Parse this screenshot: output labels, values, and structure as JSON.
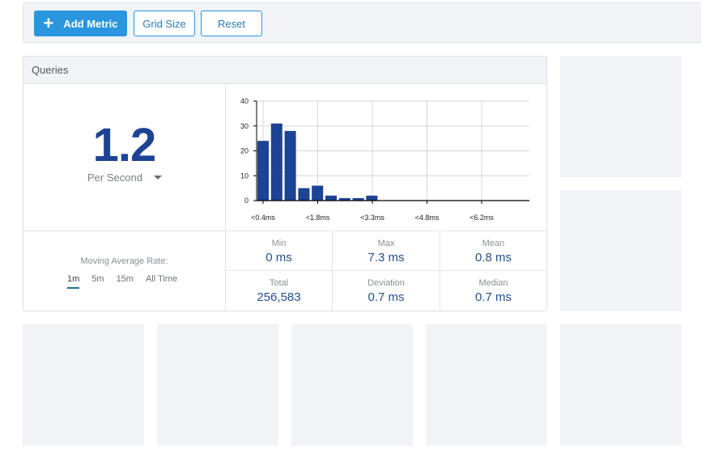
{
  "toolbar": {
    "add_metric_label": "Add Metric",
    "add_icon": "plus-icon",
    "grid_size_label": "Grid Size",
    "reset_label": "Reset"
  },
  "card": {
    "title": "Queries",
    "rate_value": "1.2",
    "rate_unit": "Per Second",
    "moving_average_label": "Moving Average Rate:",
    "rates": [
      {
        "label": "1m",
        "active": true
      },
      {
        "label": "5m",
        "active": false
      },
      {
        "label": "15m",
        "active": false
      },
      {
        "label": "All Time",
        "active": false
      }
    ],
    "stats": [
      {
        "label": "Min",
        "value": "0 ms"
      },
      {
        "label": "Max",
        "value": "7.3 ms"
      },
      {
        "label": "Mean",
        "value": "0.8 ms"
      },
      {
        "label": "Total",
        "value": "256,583"
      },
      {
        "label": "Deviation",
        "value": "0.7 ms"
      },
      {
        "label": "Median",
        "value": "0.7 ms"
      }
    ]
  },
  "colors": {
    "primary": "#2a96e0",
    "bar": "#1c4394",
    "value_text": "#24508f",
    "placeholder": "#f1f3f7"
  },
  "chart_data": {
    "type": "bar",
    "title": "",
    "xlabel": "",
    "ylabel": "",
    "ylim": [
      0,
      40
    ],
    "yticks": [
      0,
      10,
      20,
      30,
      40
    ],
    "xtick_labels": [
      "<0.4ms",
      "<1.8ms",
      "<3.3ms",
      "<4.8ms",
      "<6.2ms"
    ],
    "values": [
      24,
      31,
      28,
      5,
      6,
      2,
      1,
      1,
      2,
      0,
      0,
      0,
      0,
      0,
      0,
      0,
      0,
      0,
      0,
      0
    ],
    "grid": true
  }
}
